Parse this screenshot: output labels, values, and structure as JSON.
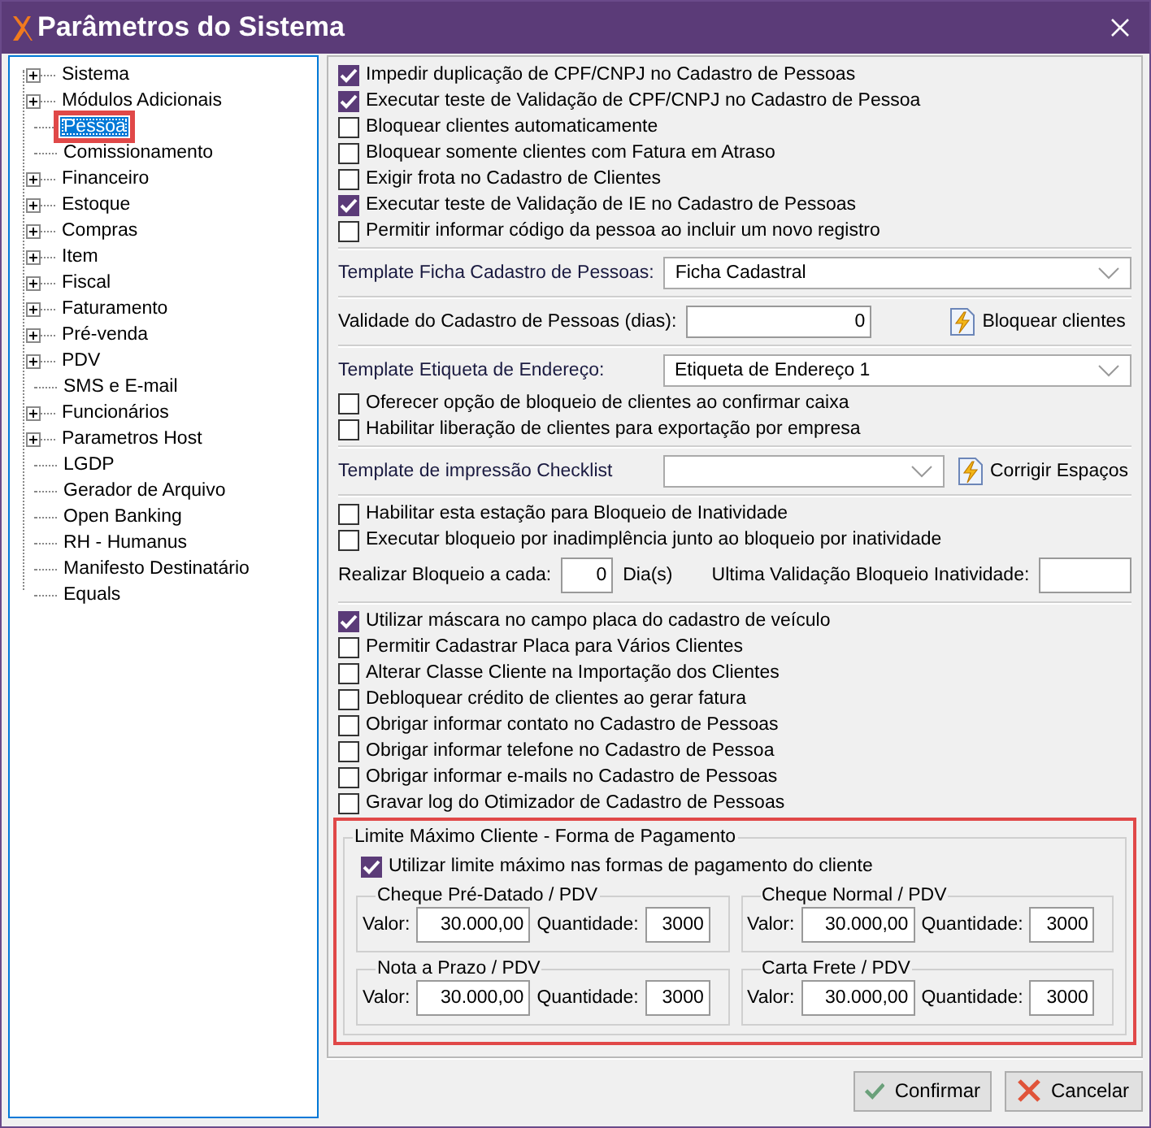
{
  "window": {
    "title": "Parâmetros do Sistema"
  },
  "tree": [
    {
      "label": "Sistema",
      "expandable": true,
      "selected": false,
      "highlighted": false
    },
    {
      "label": "Módulos Adicionais",
      "expandable": true,
      "selected": false,
      "highlighted": false
    },
    {
      "label": "Pessoa",
      "expandable": false,
      "selected": true,
      "highlighted": true
    },
    {
      "label": "Comissionamento",
      "expandable": false,
      "selected": false,
      "highlighted": false
    },
    {
      "label": "Financeiro",
      "expandable": true,
      "selected": false,
      "highlighted": false
    },
    {
      "label": "Estoque",
      "expandable": true,
      "selected": false,
      "highlighted": false
    },
    {
      "label": "Compras",
      "expandable": true,
      "selected": false,
      "highlighted": false
    },
    {
      "label": "Item",
      "expandable": true,
      "selected": false,
      "highlighted": false
    },
    {
      "label": "Fiscal",
      "expandable": true,
      "selected": false,
      "highlighted": false
    },
    {
      "label": "Faturamento",
      "expandable": true,
      "selected": false,
      "highlighted": false
    },
    {
      "label": "Pré-venda",
      "expandable": true,
      "selected": false,
      "highlighted": false
    },
    {
      "label": "PDV",
      "expandable": true,
      "selected": false,
      "highlighted": false
    },
    {
      "label": "SMS e E-mail",
      "expandable": false,
      "selected": false,
      "highlighted": false
    },
    {
      "label": "Funcionários",
      "expandable": true,
      "selected": false,
      "highlighted": false
    },
    {
      "label": "Parametros Host",
      "expandable": true,
      "selected": false,
      "highlighted": false
    },
    {
      "label": "LGDP",
      "expandable": false,
      "selected": false,
      "highlighted": false
    },
    {
      "label": "Gerador de Arquivo",
      "expandable": false,
      "selected": false,
      "highlighted": false
    },
    {
      "label": "Open Banking",
      "expandable": false,
      "selected": false,
      "highlighted": false
    },
    {
      "label": "RH - Humanus",
      "expandable": false,
      "selected": false,
      "highlighted": false
    },
    {
      "label": "Manifesto Destinatário",
      "expandable": false,
      "selected": false,
      "highlighted": false
    },
    {
      "label": "Equals",
      "expandable": false,
      "selected": false,
      "highlighted": false
    }
  ],
  "panel": [
    {
      "kind": "checkbox",
      "label": "Impedir duplicação de CPF/CNPJ no Cadastro de Pessoas",
      "checked": true
    },
    {
      "kind": "checkbox",
      "label": "Executar teste de Validação de CPF/CNPJ no Cadastro de Pessoa",
      "checked": true
    },
    {
      "kind": "checkbox",
      "label": "Bloquear clientes automaticamente",
      "checked": false
    },
    {
      "kind": "checkbox",
      "label": "Bloquear somente clientes com Fatura em Atraso",
      "checked": false
    },
    {
      "kind": "checkbox",
      "label": "Exigir frota no Cadastro de Clientes",
      "checked": false
    },
    {
      "kind": "checkbox",
      "label": "Executar teste de Validação de IE no Cadastro de Pessoas",
      "checked": true
    },
    {
      "kind": "checkbox",
      "label": "Permitir informar código da pessoa ao incluir um novo registro",
      "checked": false
    },
    {
      "kind": "separator"
    },
    {
      "kind": "select",
      "label": "Template Ficha Cadastro de Pessoas:",
      "value": "Ficha Cadastral"
    },
    {
      "kind": "separator"
    },
    {
      "kind": "number",
      "label": "Validade do Cadastro de Pessoas (dias):",
      "value": "0",
      "button": "Bloquear clientes"
    },
    {
      "kind": "separator"
    },
    {
      "kind": "select",
      "label": "Template Etiqueta de Endereço:",
      "value": "Etiqueta de Endereço 1"
    },
    {
      "kind": "checkbox",
      "label": "Oferecer opção de bloqueio de clientes ao confirmar caixa",
      "checked": false
    },
    {
      "kind": "checkbox",
      "label": "Habilitar liberação de clientes para exportação por empresa",
      "checked": false
    },
    {
      "kind": "separator"
    },
    {
      "kind": "select-button",
      "label": "Template de impressão Checklist",
      "button": "Corrigir Espaços"
    },
    {
      "kind": "separator"
    },
    {
      "kind": "checkbox",
      "label": "Habilitar esta estação para Bloqueio de Inatividade",
      "checked": false
    },
    {
      "kind": "checkbox",
      "label": "Executar bloqueio por inadimplência junto ao bloqueio por inatividade",
      "checked": false
    },
    {
      "kind": "interval",
      "label": "Realizar Bloqueio a cada:",
      "value": "0",
      "unit": "Dia(s)",
      "label_2": "Ultima Validação Bloqueio Inatividade:"
    },
    {
      "kind": "separator"
    },
    {
      "kind": "checkbox",
      "label": "Utilizar máscara no campo placa do cadastro de veículo",
      "checked": true
    },
    {
      "kind": "checkbox",
      "label": "Permitir Cadastrar Placa para Vários Clientes",
      "checked": false
    },
    {
      "kind": "checkbox",
      "label": "Alterar Classe Cliente na Importação dos Clientes",
      "checked": false
    },
    {
      "kind": "checkbox",
      "label": "Debloquear crédito de clientes ao gerar fatura",
      "checked": false
    },
    {
      "kind": "checkbox",
      "label": "Obrigar informar contato no Cadastro de Pessoas",
      "checked": false
    },
    {
      "kind": "checkbox",
      "label": "Obrigar informar telefone no Cadastro de Pessoa",
      "checked": false
    },
    {
      "kind": "checkbox",
      "label": "Obrigar informar e-mails no Cadastro de Pessoas",
      "checked": false
    },
    {
      "kind": "checkbox",
      "label": "Gravar log do Otimizador de Cadastro de Pessoas",
      "checked": false
    }
  ],
  "limit_group": {
    "title": "Limite Máximo Cliente - Forma de Pagamento",
    "highlighted": true,
    "checkbox": {
      "label": "Utilizar limite máximo nas formas de pagamento do cliente",
      "checked": true
    },
    "groups": [
      {
        "title": "Cheque Pré-Datado / PDV",
        "value_label": "Valor:",
        "value": "30.000,00",
        "quantity_label": "Quantidade:",
        "quantity": "3000"
      },
      {
        "title": "Cheque Normal / PDV",
        "value_label": "Valor:",
        "value": "30.000,00",
        "quantity_label": "Quantidade:",
        "quantity": "3000"
      },
      {
        "title": "Nota a Prazo / PDV",
        "value_label": "Valor:",
        "value": "30.000,00",
        "quantity_label": "Quantidade:",
        "quantity": "3000"
      },
      {
        "title": "Carta Frete / PDV",
        "value_label": "Valor:",
        "value": "30.000,00",
        "quantity_label": "Quantidade:",
        "quantity": "3000"
      }
    ]
  },
  "buttons": [
    {
      "kind": "confirm",
      "label": "Confirmar"
    },
    {
      "kind": "cancel",
      "label": "Cancelar"
    }
  ]
}
